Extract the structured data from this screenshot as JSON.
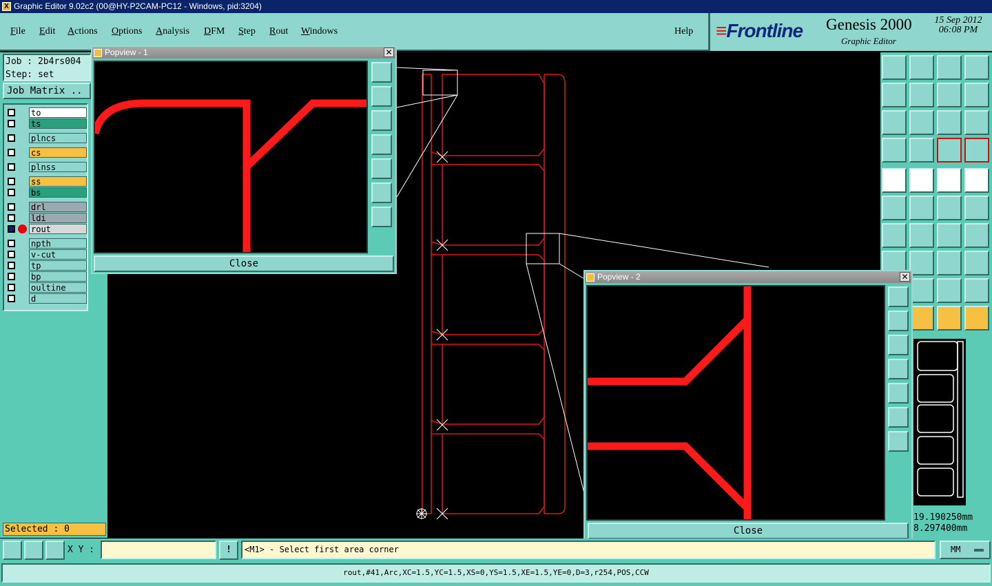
{
  "window": {
    "title": "Graphic Editor 9.02c2 (00@HY-P2CAM-PC12 - Windows, pid:3204)"
  },
  "menu": {
    "items": [
      "File",
      "Edit",
      "Actions",
      "Options",
      "Analysis",
      "DFM",
      "Step",
      "Rout",
      "Windows"
    ],
    "help": "Help"
  },
  "brand": {
    "logo": "Frontline",
    "product": "Genesis 2000",
    "subtitle": "Graphic Editor",
    "date": "15 Sep 2012",
    "time": "06:08 PM"
  },
  "job": {
    "job_line": "Job : 2b4rs004",
    "step_line": "Step: set",
    "matrix_button": "Job Matrix .."
  },
  "layers": [
    {
      "name": "to",
      "color": "#ffffff"
    },
    {
      "name": "ts",
      "color": "#2aa17d"
    },
    {
      "name": "plncs",
      "color": "#8fd6cf"
    },
    {
      "name": "cs",
      "color": "#f7c043"
    },
    {
      "name": "plnss",
      "color": "#8fd6cf"
    },
    {
      "name": "ss",
      "color": "#f7c043"
    },
    {
      "name": "bs",
      "color": "#2aa17d"
    },
    {
      "name": "drl",
      "color": "#9aaab0"
    },
    {
      "name": "ldi",
      "color": "#9aaab0"
    },
    {
      "name": "rout",
      "color": "#d8d8d8"
    },
    {
      "name": "npth",
      "color": "#8fd6cf"
    },
    {
      "name": "v-cut",
      "color": "#8fd6cf"
    },
    {
      "name": "tp",
      "color": "#8fd6cf"
    },
    {
      "name": "bp",
      "color": "#8fd6cf"
    },
    {
      "name": "oultine",
      "color": "#8fd6cf"
    },
    {
      "name": "d",
      "color": "#8fd6cf"
    }
  ],
  "selected": "Selected : 0",
  "popview1": {
    "title": "Popview - 1",
    "close": "Close"
  },
  "popview2": {
    "title": "Popview - 2",
    "close": "Close"
  },
  "coords": {
    "x": "19.190250mm",
    "y": "8.297400mm"
  },
  "cmd": {
    "xy_label": "X Y :",
    "xy_value": "",
    "prompt": "<M1> - Select first area corner",
    "unit": "MM"
  },
  "status": "rout,#41,Arc,XC=1.5,YC=1.5,XS=0,YS=1.5,XE=1.5,YE=0,D=3,r254,POS,CCW"
}
